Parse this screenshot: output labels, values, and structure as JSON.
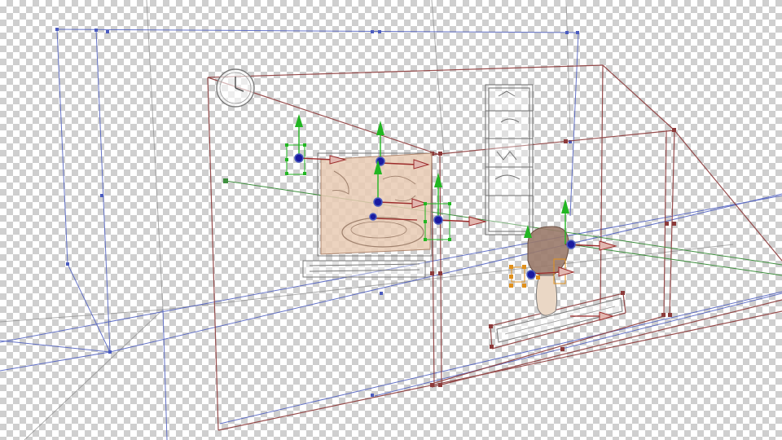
{
  "viewport": {
    "kind": "3d-scene-editor",
    "background": "transparency-checkerboard",
    "view": "perspective"
  },
  "colors": {
    "camera_frustum": "#8c3a3a",
    "world_grid": "#4a5bbf",
    "light_beam": "#3f8f3f",
    "axis_y": "#22b622",
    "axis_x": "#9c2a2a",
    "pivot": "#1a1aa0",
    "selected_handle": "#e0901c",
    "scene_sketch": "#7a7a7a",
    "screen_fill": "#e9cbb4",
    "character_fill": "#9a7a6a"
  },
  "scene": {
    "objects": [
      {
        "name": "wall-clock",
        "icon": "clock-icon"
      },
      {
        "name": "bookshelf",
        "icon": "shelf-icon"
      },
      {
        "name": "tv-screen",
        "icon": "picture-plane"
      },
      {
        "name": "character",
        "icon": "figure-icon"
      },
      {
        "name": "floor-tile",
        "icon": "tile-icon"
      }
    ],
    "gizmos": [
      {
        "id": "gizmo-frame-left"
      },
      {
        "id": "gizmo-frame-top"
      },
      {
        "id": "gizmo-frame-mid"
      },
      {
        "id": "gizmo-frame-right"
      },
      {
        "id": "gizmo-character-head"
      },
      {
        "id": "gizmo-character-body"
      }
    ]
  }
}
